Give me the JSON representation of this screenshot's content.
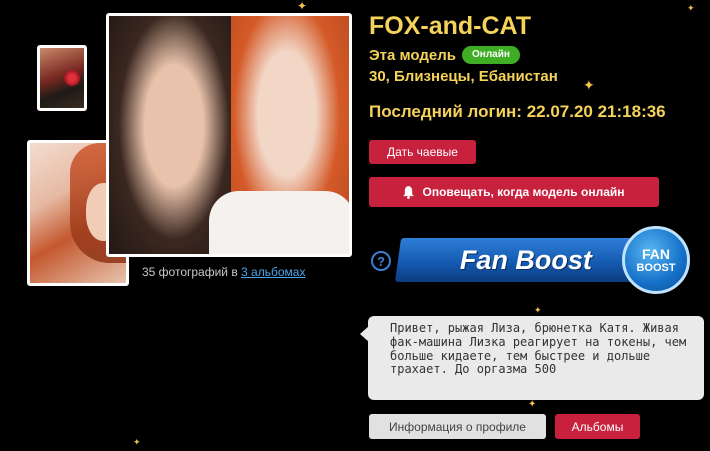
{
  "profile": {
    "name": "FOX-and-CAT",
    "model_label": "Эта модель",
    "online_badge": "Онлайн",
    "location": "30, Близнецы, Ебанистан",
    "last_login": "Последний логин: 22.07.20 21:18:36"
  },
  "photos": {
    "caption_prefix": "35 фотографий в ",
    "albums_link": "3 альбомах"
  },
  "actions": {
    "tip_label": "Дать чаевые",
    "notify_label": "Оповещать, когда модель онлайн",
    "fanboost_label": "Fan Boost",
    "fanboost_badge_top": "FAN",
    "fanboost_badge_bottom": "BOOST",
    "help_glyph": "?"
  },
  "bio": {
    "text": "Привет, рыжая Лиза, брюнетка Катя. Живая фак-машина Лизка реагирует на токены, чем больше кидаете, тем быстрее и дольше трахает. До оргазма 500"
  },
  "footer": {
    "info_label": "Информация о профиле",
    "albums_label": "Альбомы"
  },
  "colors": {
    "accent_yellow": "#f5d25a",
    "button_red": "#c8213e",
    "online_green": "#3fae24",
    "fanboost_blue": "#155bb2",
    "link_blue": "#4da3e8"
  }
}
